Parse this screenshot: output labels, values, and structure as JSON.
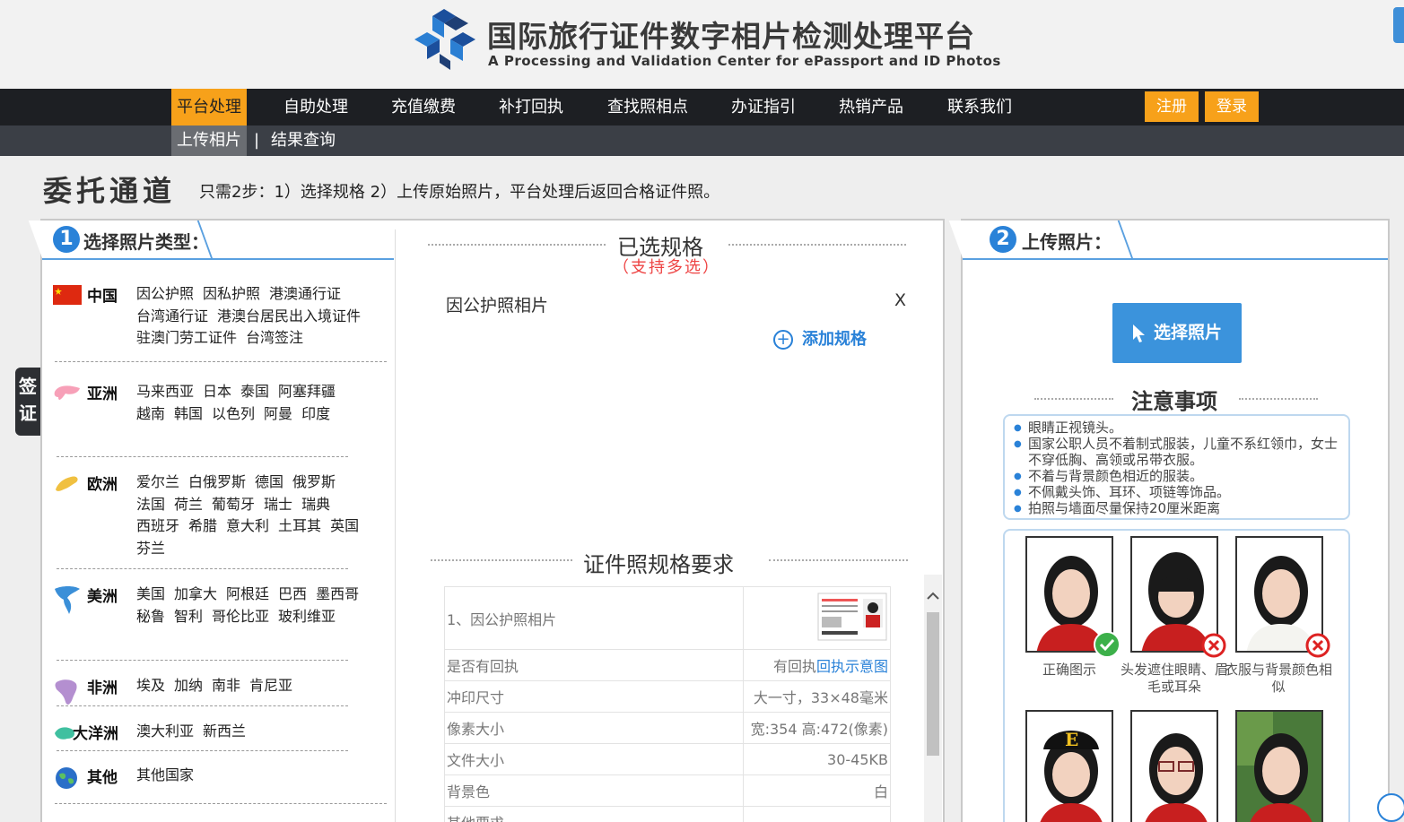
{
  "header": {
    "title_cn": "国际旅行证件数字相片检测处理平台",
    "title_en": "A Processing and Validation Center for ePassport and ID Photos"
  },
  "nav": {
    "items": [
      "平台处理",
      "自助处理",
      "充值缴费",
      "补打回执",
      "查找照相点",
      "办证指引",
      "热销产品",
      "联系我们"
    ],
    "register": "注册",
    "login": "登录",
    "sub_items": [
      "上传相片",
      "结果查询"
    ],
    "sub_sep": "|"
  },
  "page": {
    "title": "委托通道",
    "desc": "只需2步：1）选择规格 2）上传原始照片，平台处理后返回合格证件照。"
  },
  "side_tab": [
    "签",
    "证"
  ],
  "left": {
    "tab_num": "1",
    "tab_label": "选择照片类型：",
    "regions": [
      {
        "name": "中国",
        "countries": [
          "因公护照",
          "因私护照",
          "港澳通行证",
          "台湾通行证",
          "港澳台居民出入境证件",
          "驻澳门劳工证件",
          "台湾签注"
        ]
      },
      {
        "name": "亚洲",
        "countries": [
          "马来西亚",
          "日本",
          "泰国",
          "阿塞拜疆",
          "越南",
          "韩国",
          "以色列",
          "阿曼",
          "印度"
        ]
      },
      {
        "name": "欧洲",
        "countries": [
          "爱尔兰",
          "白俄罗斯",
          "德国",
          "俄罗斯",
          "法国",
          "荷兰",
          "葡萄牙",
          "瑞士",
          "瑞典",
          "西班牙",
          "希腊",
          "意大利",
          "土耳其",
          "英国",
          "芬兰"
        ]
      },
      {
        "name": "美洲",
        "countries": [
          "美国",
          "加拿大",
          "阿根廷",
          "巴西",
          "墨西哥",
          "秘鲁",
          "智利",
          "哥伦比亚",
          "玻利维亚"
        ]
      },
      {
        "name": "非洲",
        "countries": [
          "埃及",
          "加纳",
          "南非",
          "肯尼亚"
        ]
      },
      {
        "name": "大洋洲",
        "countries": [
          "澳大利亚",
          "新西兰"
        ]
      },
      {
        "name": "其他",
        "countries": [
          "其他国家"
        ]
      }
    ]
  },
  "middle": {
    "selected_title": "已选规格",
    "multi_hint": "（支持多选）",
    "selected_item": "因公护照相片",
    "remove": "X",
    "add_spec": "添加规格",
    "req_title": "证件照规格要求",
    "spec_rows": [
      {
        "label": "1、因公护照相片",
        "value": ""
      },
      {
        "label": "是否有回执",
        "value": "有回执",
        "link": "回执示意图"
      },
      {
        "label": "冲印尺寸",
        "value": "大一寸，33×48毫米"
      },
      {
        "label": "像素大小",
        "value": "宽:354 高:472(像素)"
      },
      {
        "label": "文件大小",
        "value": "30-45KB"
      },
      {
        "label": "背景色",
        "value": "白"
      },
      {
        "label": "其他要求",
        "value": ""
      }
    ]
  },
  "right": {
    "tab_num": "2",
    "tab_label": "上传照片：",
    "pick_button": "选择照片",
    "notes_title": "注意事项",
    "notes": [
      "眼睛正视镜头。",
      "国家公职人员不着制式服装，儿童不系红领巾，女士不穿低胸、高领或吊带衣服。",
      "不着与背景颜色相近的服装。",
      "不佩戴头饰、耳环、项链等饰品。",
      "拍照与墙面尽量保持20厘米距离"
    ],
    "photo_captions": [
      "正确图示",
      "头发遮住眼睛、眉毛或耳朵",
      "衣服与背景颜色相似"
    ]
  },
  "colors": {
    "accent": "#f7a11a",
    "nav_bg": "#1d1f23",
    "subnav_bg": "#3b3f46",
    "blue": "#2a82d8"
  }
}
